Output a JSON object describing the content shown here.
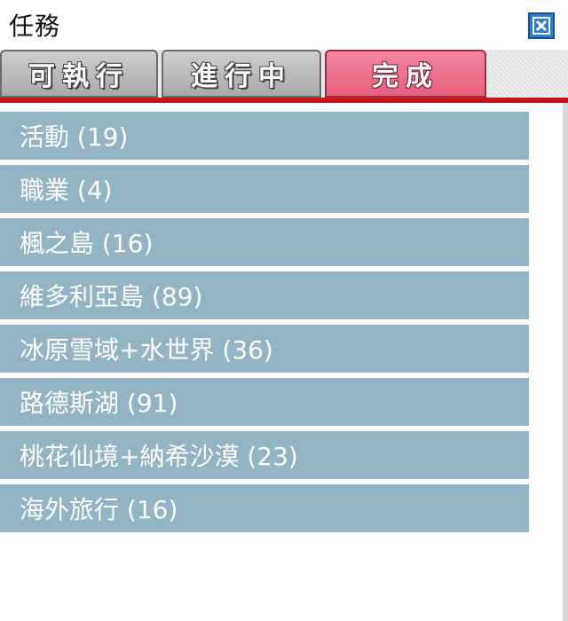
{
  "window": {
    "title": "任務"
  },
  "tabs": [
    {
      "label": "可執行",
      "active": false
    },
    {
      "label": "進行中",
      "active": false
    },
    {
      "label": "完成",
      "active": true
    }
  ],
  "quest_categories": [
    {
      "label": "活動 (19)"
    },
    {
      "label": "職業 (4)"
    },
    {
      "label": "楓之島 (16)"
    },
    {
      "label": "維多利亞島 (89)"
    },
    {
      "label": "冰原雪域+水世界 (36)"
    },
    {
      "label": "路德斯湖 (91)"
    },
    {
      "label": "桃花仙境+納希沙漠 (23)"
    },
    {
      "label": "海外旅行 (16)"
    }
  ],
  "colors": {
    "active_tab": "#e45f7d",
    "list_item_bg": "#93b4c4",
    "accent_line": "#c4141e",
    "close_button": "#2b7fd0"
  },
  "icons": {
    "close": "close-icon"
  }
}
